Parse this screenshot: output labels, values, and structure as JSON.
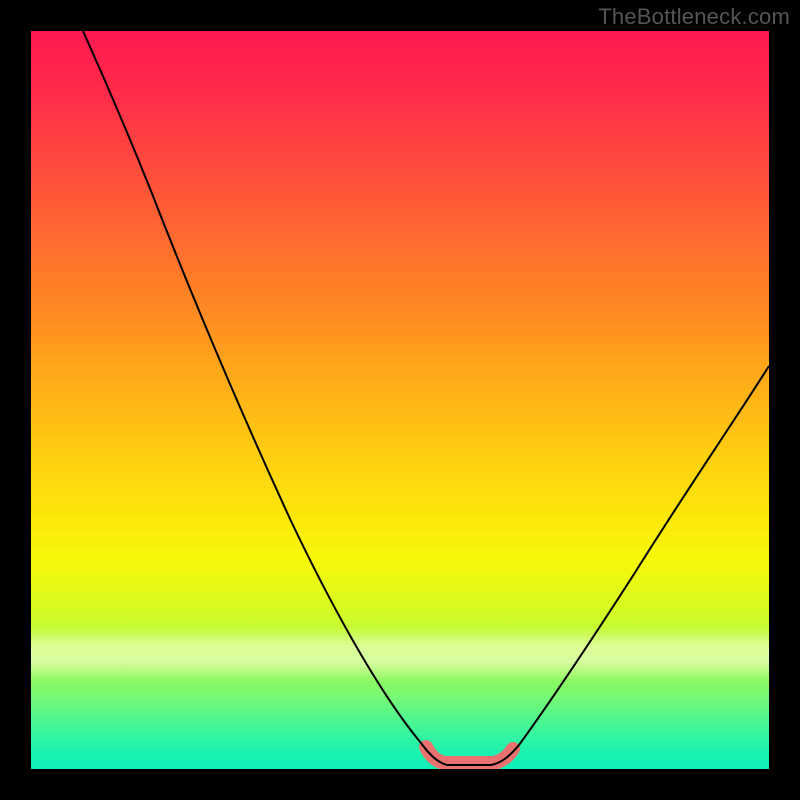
{
  "watermark": "TheBottleneck.com",
  "chart_data": {
    "type": "line",
    "title": "",
    "xlabel": "",
    "ylabel": "",
    "xlim": [
      0,
      100
    ],
    "ylim": [
      0,
      100
    ],
    "grid": false,
    "legend": false,
    "series": [
      {
        "name": "left-curve",
        "x": [
          7,
          12,
          18,
          24,
          30,
          36,
          42,
          47,
          51,
          54,
          56
        ],
        "values": [
          100,
          90,
          77,
          64,
          51,
          38,
          26,
          15,
          7,
          2,
          0
        ]
      },
      {
        "name": "valley-floor",
        "x": [
          56,
          59,
          62,
          65
        ],
        "values": [
          0,
          0,
          0,
          0
        ]
      },
      {
        "name": "right-curve",
        "x": [
          65,
          70,
          76,
          82,
          88,
          94,
          100
        ],
        "values": [
          0,
          4,
          12,
          22,
          33,
          44,
          55
        ]
      }
    ],
    "highlight": {
      "name": "valley-marker",
      "color": "#e9716f",
      "x": [
        54,
        56,
        59,
        62,
        64,
        65
      ],
      "values": [
        2,
        0,
        0,
        0,
        0,
        1
      ]
    },
    "background": "rainbow-gradient-vertical"
  }
}
